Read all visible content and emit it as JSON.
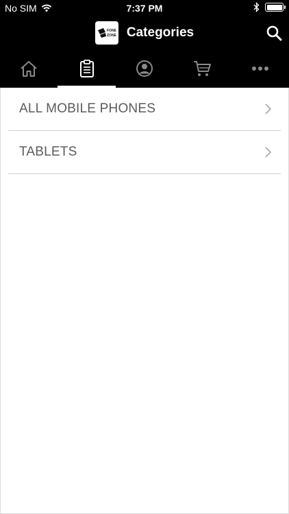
{
  "status_bar": {
    "carrier": "No SIM",
    "time": "7:37 PM",
    "wifi_icon": "wifi-icon",
    "bluetooth_icon": "bluetooth-icon",
    "battery_icon": "battery-icon",
    "battery_level": 1.0
  },
  "header": {
    "title": "Categories",
    "logo_text": "FONE ZONE",
    "logo_icon": "fone-zone-logo",
    "search_icon": "search-icon"
  },
  "tabs": [
    {
      "icon": "home-icon",
      "active": false
    },
    {
      "icon": "clipboard-icon",
      "active": true
    },
    {
      "icon": "user-icon",
      "active": false
    },
    {
      "icon": "cart-icon",
      "active": false
    },
    {
      "icon": "more-icon",
      "active": false
    }
  ],
  "categories": [
    {
      "label": "ALL MOBILE PHONES",
      "icon": "chevron-right-icon"
    },
    {
      "label": "TABLETS",
      "icon": "chevron-right-icon"
    }
  ],
  "colors": {
    "bar_background": "#000000",
    "content_background": "#ffffff",
    "label_text": "#5b5b5b",
    "divider": "#cfcfcf",
    "chevron": "#9a9a9a"
  }
}
